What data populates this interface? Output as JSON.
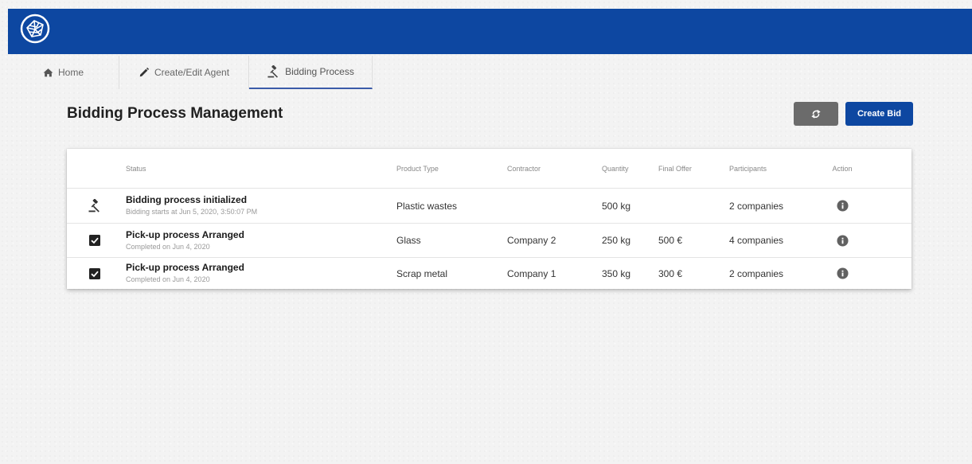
{
  "tabs": [
    {
      "label": "Home",
      "icon": "home-icon"
    },
    {
      "label": "Create/Edit Agent",
      "icon": "pencil-icon"
    },
    {
      "label": "Bidding Process",
      "icon": "gavel-icon",
      "active": true
    }
  ],
  "page": {
    "title": "Bidding Process Management",
    "refresh_icon": "refresh-icon",
    "create_label": "Create Bid"
  },
  "table": {
    "headers": {
      "status": "Status",
      "product": "Product Type",
      "contractor": "Contractor",
      "quantity": "Quantity",
      "offer": "Final Offer",
      "participants": "Participants",
      "action": "Action"
    },
    "rows": [
      {
        "icon": "gavel-icon",
        "status": "Bidding process initialized",
        "sub": "Bidding starts at Jun 5, 2020, 3:50:07 PM",
        "product": "Plastic wastes",
        "contractor": "",
        "quantity": "500 kg",
        "offer": "",
        "participants": "2 companies",
        "action_icon": "info-icon"
      },
      {
        "icon": "checkbox-checked-icon",
        "status": "Pick-up process Arranged",
        "sub": "Completed on Jun 4, 2020",
        "product": "Glass",
        "contractor": "Company 2",
        "quantity": "250 kg",
        "offer": "500 €",
        "participants": "4 companies",
        "action_icon": "info-icon"
      },
      {
        "icon": "checkbox-checked-icon",
        "status": "Pick-up process Arranged",
        "sub": "Completed on Jun 4, 2020",
        "product": "Scrap metal",
        "contractor": "Company 1",
        "quantity": "350 kg",
        "offer": "300 €",
        "participants": "2 companies",
        "action_icon": "info-icon"
      }
    ]
  },
  "colors": {
    "brand": "#0d47a1",
    "refresh_button": "#6b6b6b",
    "action_icon": "#616161"
  }
}
